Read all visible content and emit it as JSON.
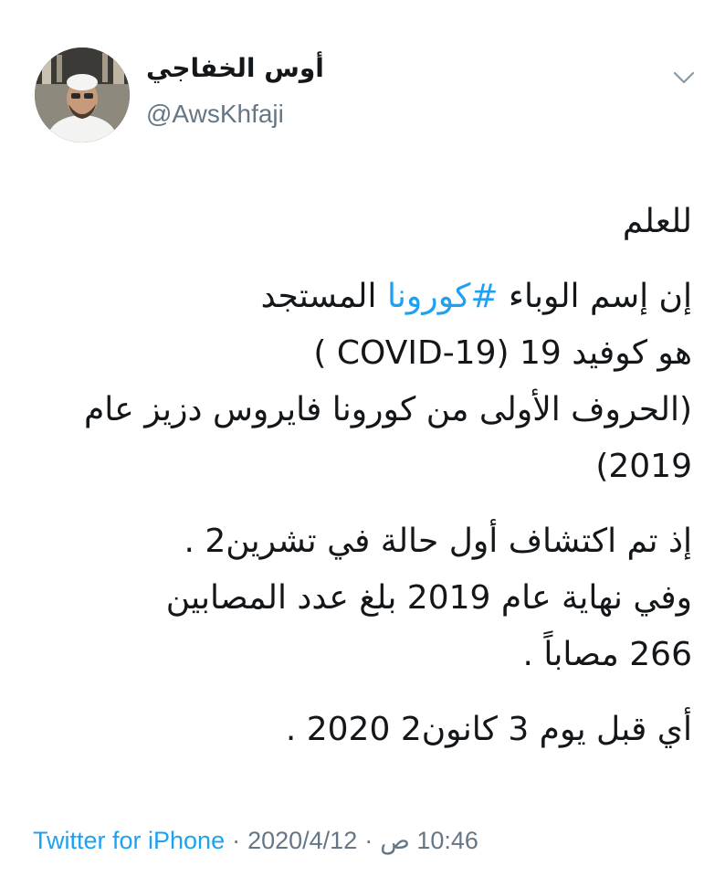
{
  "user": {
    "display_name": "أوس الخفاجي",
    "handle": "@AwsKhfaji"
  },
  "tweet": {
    "line1": "للعلم",
    "line2_pre": "إن إسم الوباء ",
    "line2_hashtag": "#كورونا",
    "line2_post": " المستجد",
    "line3": "هو كوفيد 19 (COVID-19 )",
    "line4": "(الحروف الأولى من كورونا فايروس دزيز عام",
    "line5": "(2019",
    "line6": "إذ تم اكتشاف أول حالة في تشرين2 .",
    "line7": "وفي نهاية عام 2019 بلغ عدد المصابين",
    "line8": "266 مصاباً .",
    "line9": "أي قبل يوم 3 كانون2 2020 ."
  },
  "footer": {
    "source": "Twitter for iPhone",
    "date": "2020/4/12",
    "time": "10:46 ص",
    "separator": "·"
  },
  "icons": {
    "menu": "chevron-down-icon"
  },
  "colors": {
    "hashtag": "#1da1f2",
    "muted": "#657786",
    "text": "#14171a"
  }
}
